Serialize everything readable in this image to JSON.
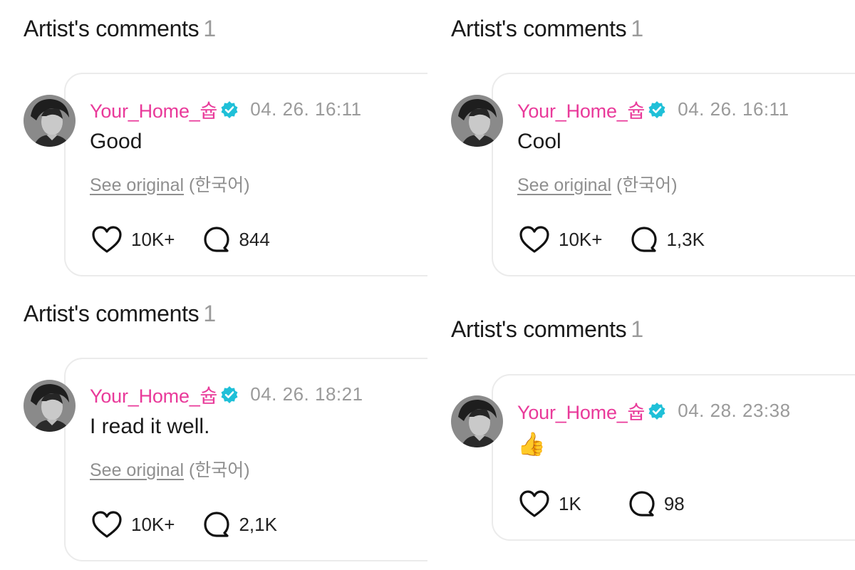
{
  "panels": [
    {
      "heading": "Artist's comments",
      "count": "1",
      "author": "Your_Home_슙",
      "date": "04. 26. 16:11",
      "text": "Good",
      "see_original": "See original",
      "language": "(한국어)",
      "likes": "10K+",
      "comments": "844",
      "icons": {
        "like": "heart-icon",
        "comment": "comment-bubble-icon",
        "verified": "verified-badge-icon"
      }
    },
    {
      "heading": "Artist's comments",
      "count": "1",
      "author": "Your_Home_슙",
      "date": "04. 26. 16:11",
      "text": "Cool",
      "see_original": "See original",
      "language": "(한국어)",
      "likes": "10K+",
      "comments": "1,3K",
      "icons": {
        "like": "heart-icon",
        "comment": "comment-bubble-icon",
        "verified": "verified-badge-icon"
      }
    },
    {
      "heading": "Artist's comments",
      "count": "1",
      "author": "Your_Home_슙",
      "date": "04. 26. 18:21",
      "text": "I read it well.",
      "see_original": "See original",
      "language": "(한국어)",
      "likes": "10K+",
      "comments": "2,1K",
      "icons": {
        "like": "heart-icon",
        "comment": "comment-bubble-icon",
        "verified": "verified-badge-icon"
      }
    },
    {
      "heading": "Artist's comments",
      "count": "1",
      "author": "Your_Home_슙",
      "date": "04. 28. 23:38",
      "text": "👍",
      "likes": "1K",
      "comments": "98",
      "icons": {
        "like": "heart-icon",
        "comment": "comment-bubble-icon",
        "verified": "verified-badge-icon"
      }
    }
  ],
  "colors": {
    "author": "#e93a9a",
    "verified": "#1fc0d8",
    "muted": "#9a9a9a",
    "card_border": "#ebebeb"
  }
}
